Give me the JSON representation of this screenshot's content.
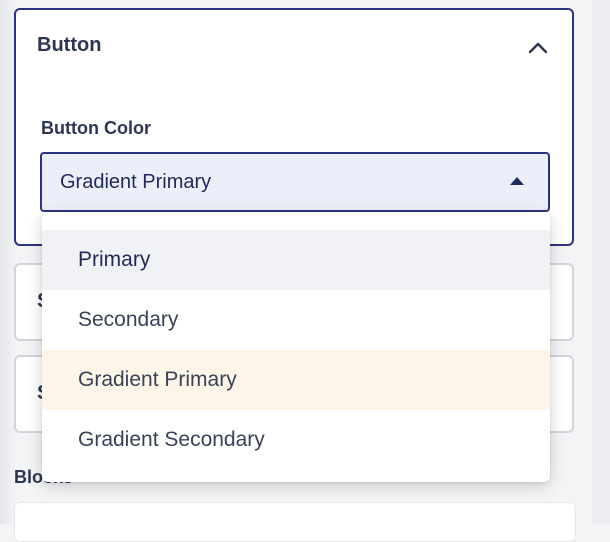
{
  "button_panel": {
    "title": "Button",
    "color_field": {
      "label": "Button Color",
      "selected_value": "Gradient Primary",
      "options": [
        "Primary",
        "Secondary",
        "Gradient Primary",
        "Gradient Secondary"
      ]
    }
  },
  "collapsed_panels": [
    "S",
    "S"
  ],
  "blocks_section": {
    "label": "Blocks"
  },
  "colors": {
    "accent": "#2c3382",
    "hover_option_bg": "#f1f2f5",
    "selected_option_bg": "#fdf6e8"
  },
  "icons": {
    "collapse": "chevron-up-icon",
    "dropdown_caret": "caret-up-icon"
  }
}
